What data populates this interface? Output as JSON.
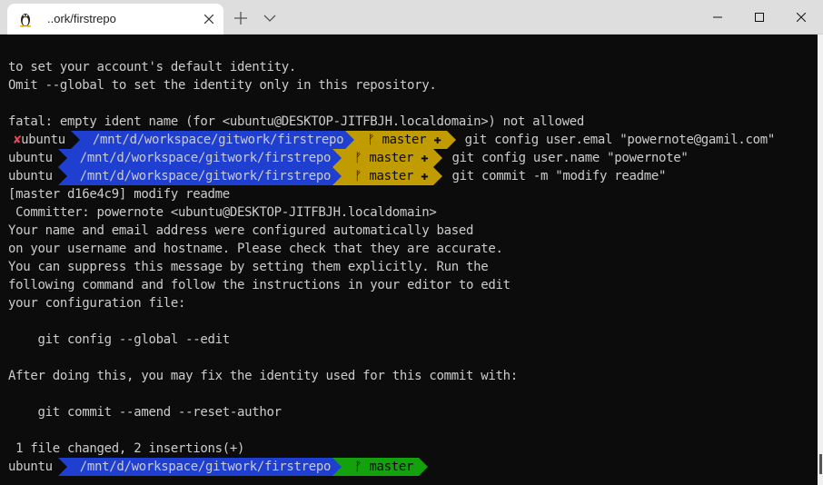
{
  "window": {
    "tab_title": "..ork/firstrepo",
    "colors": {
      "titlebar": "#dedede",
      "terminal_bg": "#0c0c0c",
      "path_bg": "#1f3fd0",
      "dirty_branch_bg": "#c19c00",
      "clean_branch_bg": "#13a10e",
      "error": "#e74856"
    }
  },
  "terminal": {
    "lines_top": [
      "to set your account's default identity.",
      "Omit --global to set the identity only in this repository.",
      "",
      "fatal: empty ident name (for <ubuntu@DESKTOP-JITFBJH.localdomain>) not allowed"
    ],
    "prompts": [
      {
        "error_mark": "✘",
        "user": "ubuntu",
        "path": "/mnt/d/workspace/gitwork/firstrepo",
        "branch": "ᚠ master ✚",
        "command": "git config user.emal \"powernote@gamil.com\""
      },
      {
        "error_mark": "",
        "user": "ubuntu",
        "path": "/mnt/d/workspace/gitwork/firstrepo",
        "branch": "ᚠ master ✚",
        "command": "git config user.name \"powernote\""
      },
      {
        "error_mark": "",
        "user": "ubuntu",
        "path": "/mnt/d/workspace/gitwork/firstrepo",
        "branch": "ᚠ master ✚",
        "command": "git commit -m \"modify readme\""
      }
    ],
    "lines_mid": [
      "[master d16e4c9] modify readme",
      " Committer: powernote <ubuntu@DESKTOP-JITFBJH.localdomain>",
      "Your name and email address were configured automatically based",
      "on your username and hostname. Please check that they are accurate.",
      "You can suppress this message by setting them explicitly. Run the",
      "following command and follow the instructions in your editor to edit",
      "your configuration file:",
      "",
      "    git config --global --edit",
      "",
      "After doing this, you may fix the identity used for this commit with:",
      "",
      "    git commit --amend --reset-author",
      "",
      " 1 file changed, 2 insertions(+)"
    ],
    "final_prompt": {
      "user": "ubuntu",
      "path": "/mnt/d/workspace/gitwork/firstrepo",
      "branch": "ᚠ master"
    }
  }
}
